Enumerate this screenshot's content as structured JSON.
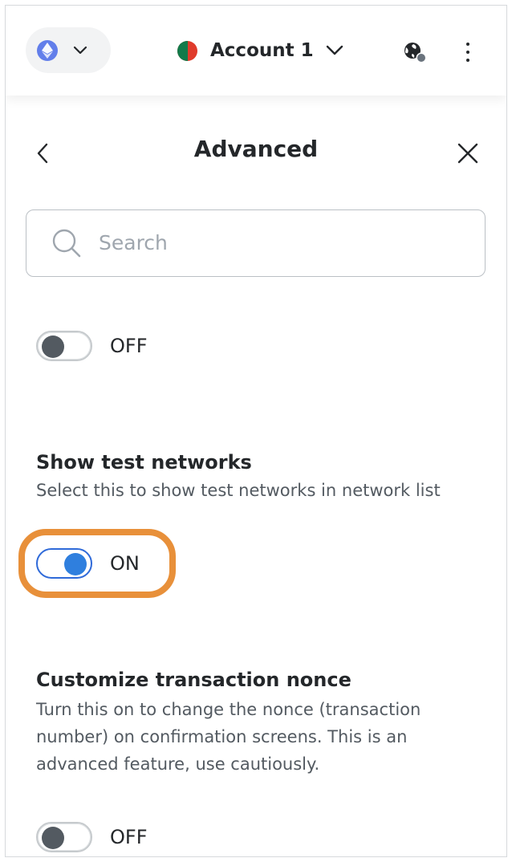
{
  "header": {
    "network_icon": "ethereum-icon",
    "account_name": "Account 1",
    "connected_sites_icon": "globe-icon",
    "menu_icon": "kebab-menu-icon"
  },
  "page": {
    "title": "Advanced",
    "back_icon": "chevron-left-icon",
    "close_icon": "close-icon"
  },
  "search": {
    "placeholder": "Search",
    "value": ""
  },
  "settings": [
    {
      "toggle_state": "OFF",
      "on": false
    },
    {
      "title": "Show test networks",
      "description": "Select this to show test networks in network list",
      "toggle_state": "ON",
      "on": true
    },
    {
      "title": "Customize transaction nonce",
      "description": "Turn this on to change the nonce (transaction number) on confirmation screens. This is an advanced feature, use cautiously.",
      "toggle_state": "OFF",
      "on": false
    }
  ],
  "colors": {
    "accent": "#2f7fde",
    "highlight": "#e8903a",
    "text": "#24272a",
    "muted": "#535a61"
  }
}
